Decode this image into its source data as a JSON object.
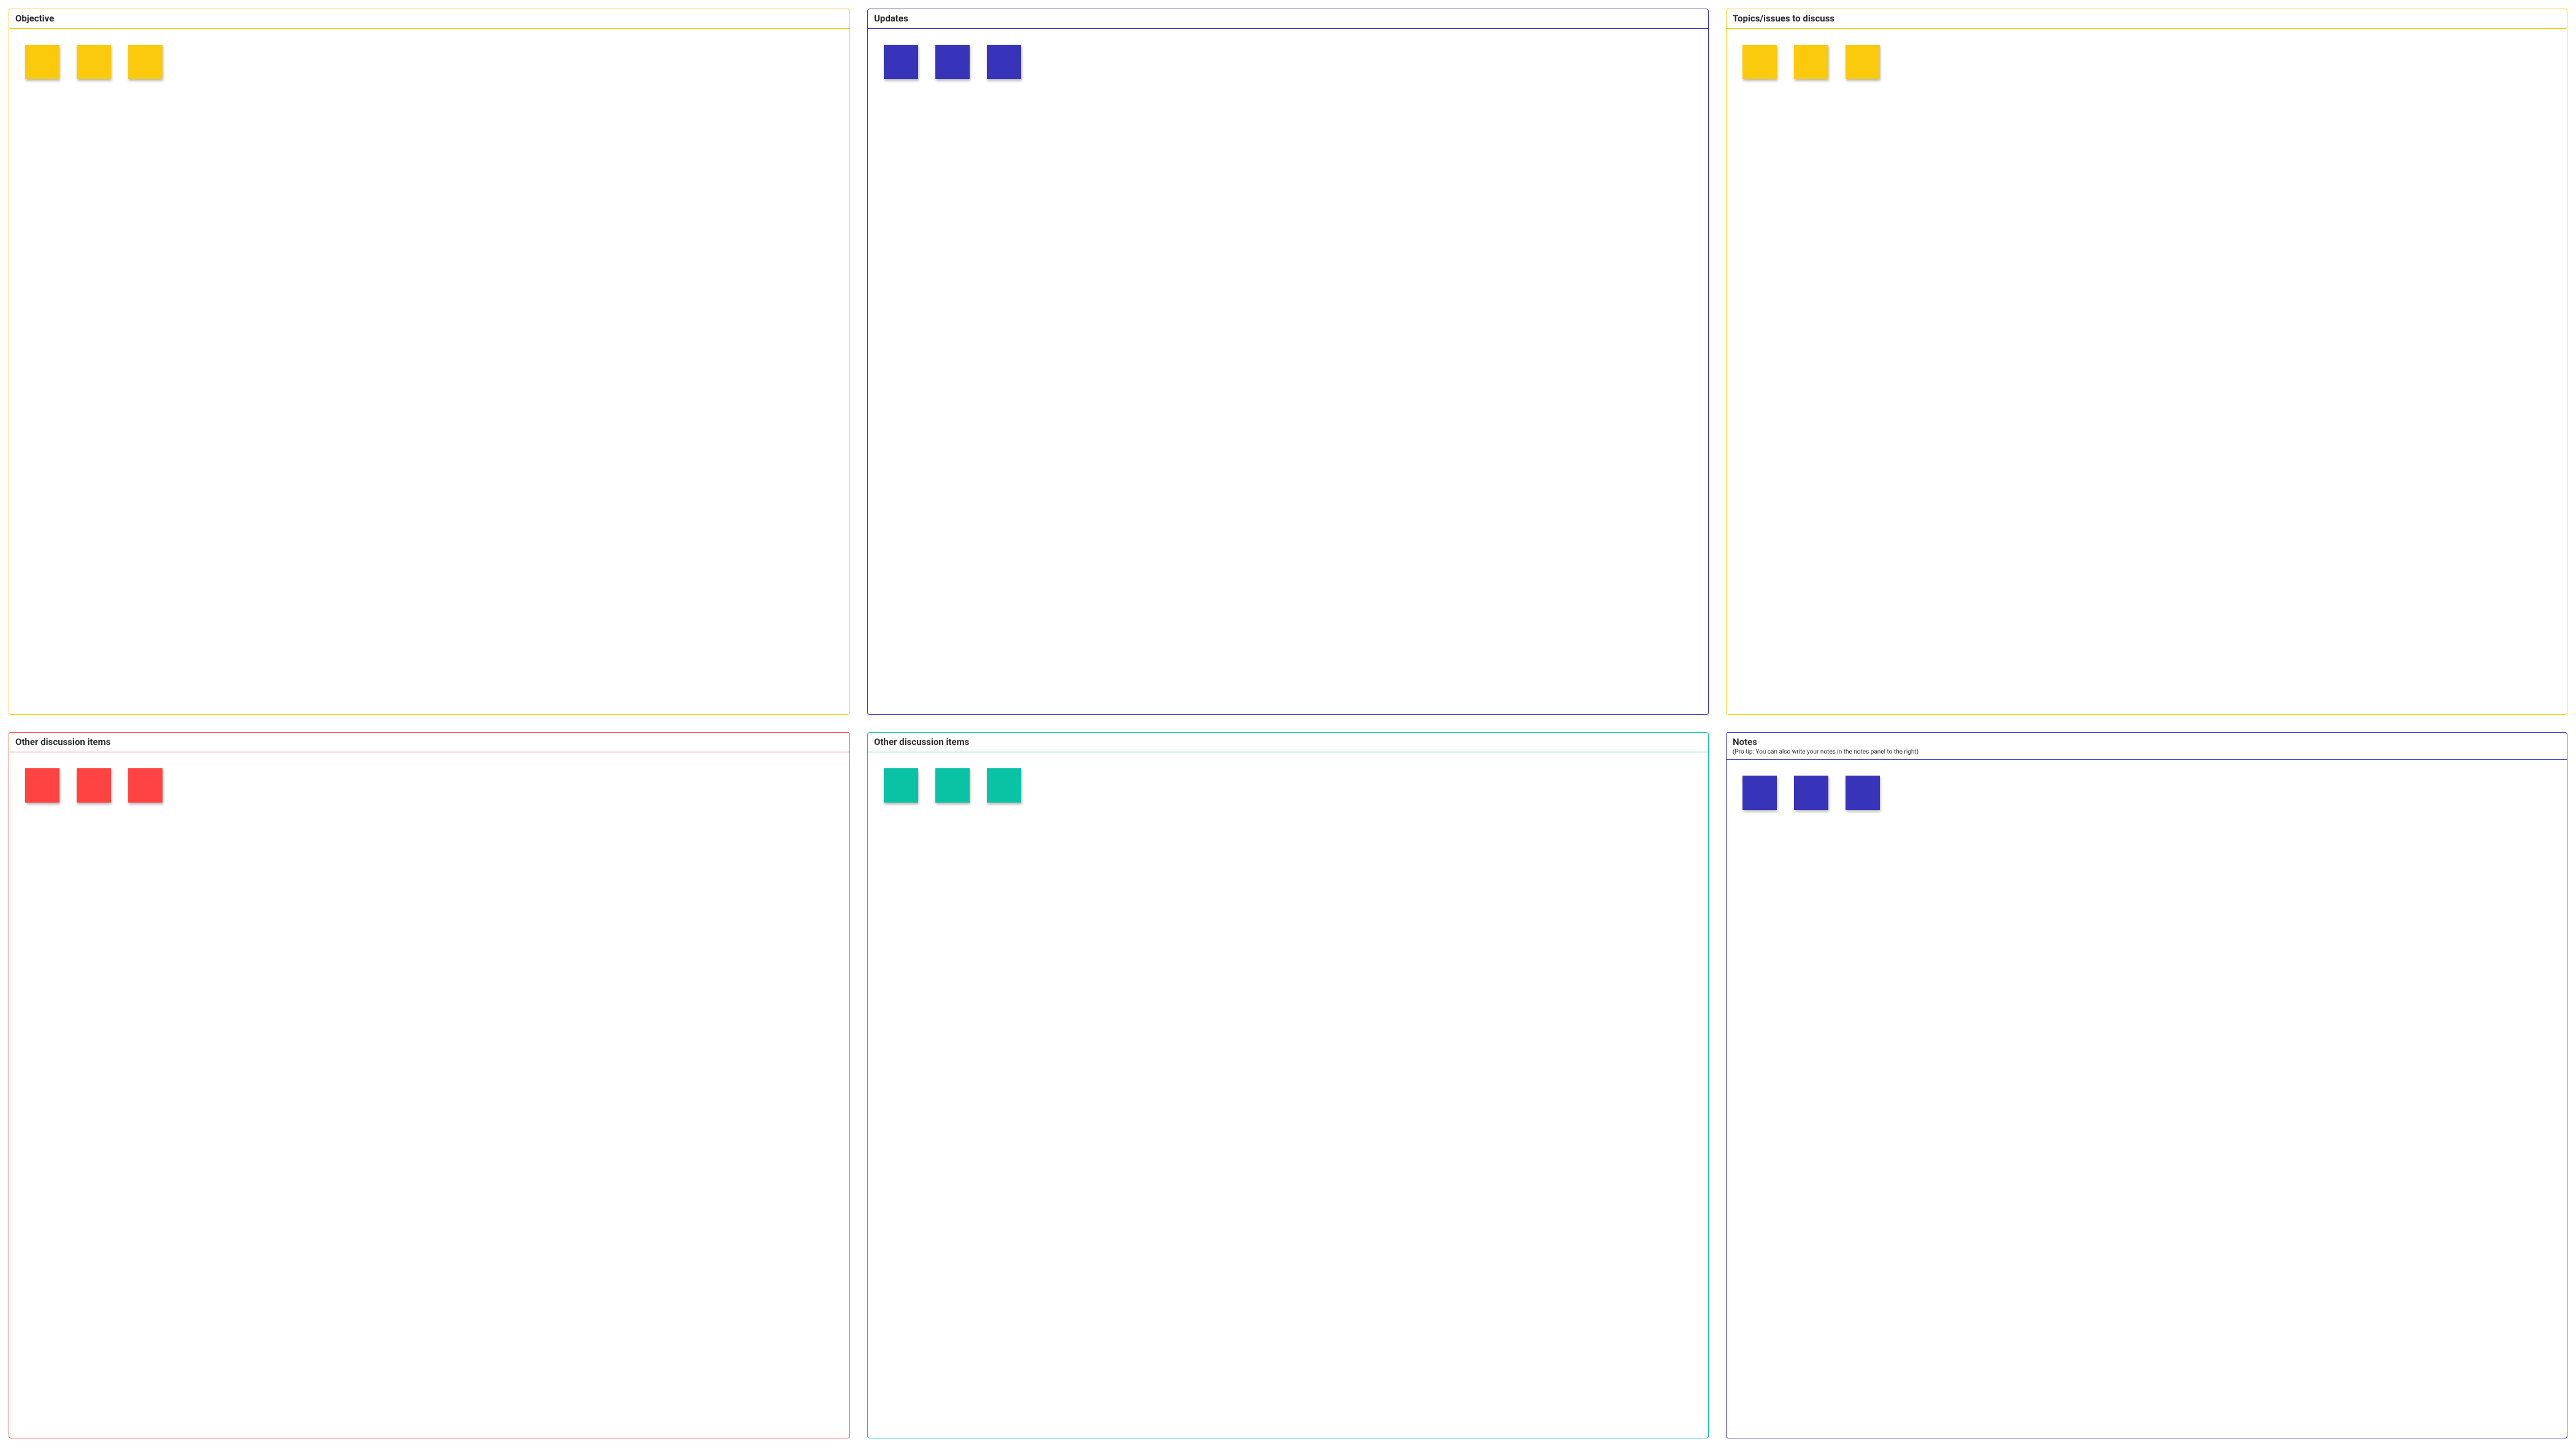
{
  "colors": {
    "yellow": "#fbca0d",
    "blue": "#3734b9",
    "red": "#ff4343",
    "teal": "#0ac2a4",
    "sticky_yellow": "#fbca0d",
    "sticky_blue": "#3734b9",
    "sticky_red": "#ff4343",
    "sticky_teal": "#0ac2a4"
  },
  "panels": [
    {
      "id": "objective",
      "title": "Objective",
      "subtitle": "",
      "border_color": "yellow",
      "sticky_color": "sticky_yellow",
      "sticky_count": 3
    },
    {
      "id": "updates",
      "title": "Updates",
      "subtitle": "",
      "border_color": "blue",
      "sticky_color": "sticky_blue",
      "sticky_count": 3
    },
    {
      "id": "topics",
      "title": "Topics/issues to discuss",
      "subtitle": "",
      "border_color": "yellow",
      "sticky_color": "sticky_yellow",
      "sticky_count": 3
    },
    {
      "id": "other-red",
      "title": "Other discussion items",
      "subtitle": "",
      "border_color": "red",
      "sticky_color": "sticky_red",
      "sticky_count": 3
    },
    {
      "id": "other-teal",
      "title": "Other discussion items",
      "subtitle": "",
      "border_color": "teal",
      "sticky_color": "sticky_teal",
      "sticky_count": 3
    },
    {
      "id": "notes",
      "title": "Notes",
      "subtitle": "(Pro tip: You can also write your notes in the notes panel to the right)",
      "border_color": "blue",
      "sticky_color": "sticky_blue",
      "sticky_count": 3
    }
  ]
}
